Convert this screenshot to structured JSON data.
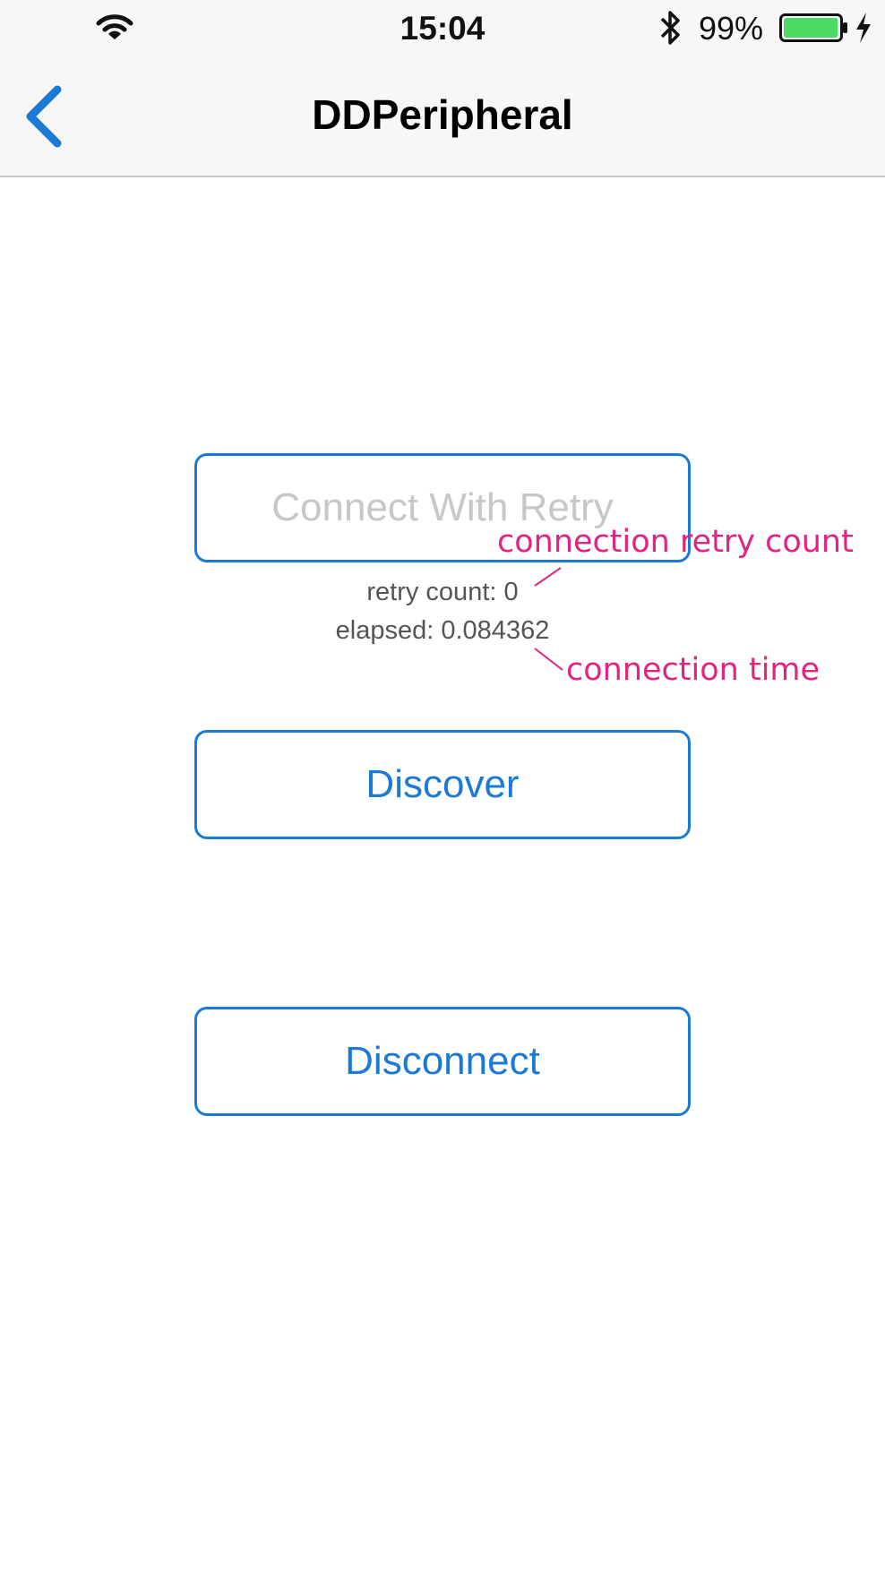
{
  "status_bar": {
    "time": "15:04",
    "battery_percent": "99%",
    "battery_level": 0.99,
    "battery_color": "#4cd964",
    "icons": [
      "wifi-icon",
      "bluetooth-icon",
      "battery-icon",
      "charging-icon"
    ]
  },
  "nav_bar": {
    "title": "DDPeripheral",
    "back_icon": "chevron-left-icon",
    "accent_color": "#1a7ad6"
  },
  "main": {
    "connect_button": {
      "label": "Connect With Retry",
      "enabled": false
    },
    "retry_count": "retry count: 0",
    "elapsed": "elapsed: 0.084362",
    "discover_button": {
      "label": "Discover"
    },
    "disconnect_button": {
      "label": "Disconnect"
    }
  },
  "annotations": {
    "retry_count_label": "connection retry count",
    "elapsed_label": "connection time",
    "color": "#e0247f"
  }
}
